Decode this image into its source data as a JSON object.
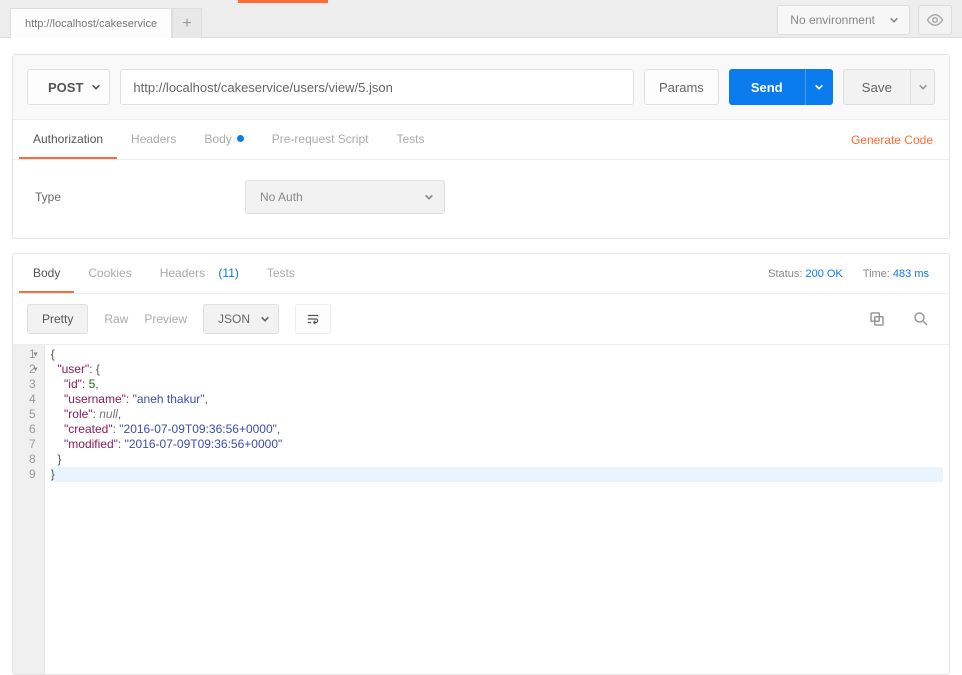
{
  "tabs": {
    "tab0": "http://localhost/cakeservice"
  },
  "env": {
    "label": "No environment"
  },
  "request": {
    "method": "POST",
    "url": "http://localhost/cakeservice/users/view/5.json",
    "params_label": "Params",
    "send_label": "Send",
    "save_label": "Save"
  },
  "req_tabs": {
    "authorization": "Authorization",
    "headers": "Headers",
    "body": "Body",
    "prerequest": "Pre-request Script",
    "tests": "Tests",
    "generate_code": "Generate Code"
  },
  "auth": {
    "type_label": "Type",
    "value": "No Auth"
  },
  "resp_tabs": {
    "body": "Body",
    "cookies": "Cookies",
    "headers": "Headers",
    "headers_count": "(11)",
    "tests": "Tests"
  },
  "status": {
    "status_label": "Status:",
    "status_value": "200 OK",
    "time_label": "Time:",
    "time_value": "483 ms"
  },
  "toolbar": {
    "pretty": "Pretty",
    "raw": "Raw",
    "preview": "Preview",
    "format": "JSON"
  },
  "response_body": {
    "user": {
      "id": 5,
      "username": "aneh thakur",
      "role": null,
      "created": "2016-07-09T09:36:56+0000",
      "modified": "2016-07-09T09:36:56+0000"
    }
  },
  "code_lines": {
    "l1": "{",
    "l9": "}"
  }
}
